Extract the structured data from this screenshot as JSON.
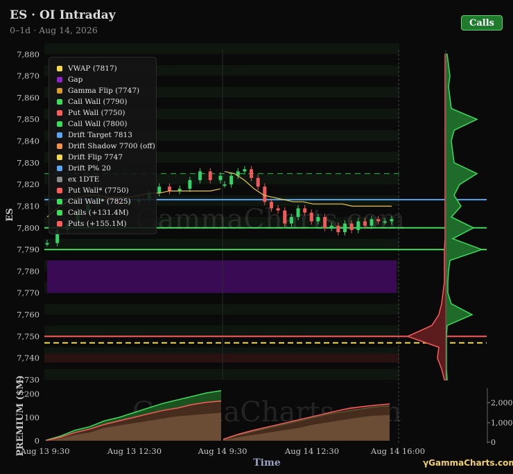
{
  "header": {
    "title": "ES · OI Intraday",
    "subtitle": "0–1d · Aug 14, 2026",
    "calls_button": "Calls"
  },
  "colors": {
    "background": "#0a0a0a",
    "call": "#3ddc5a",
    "put": "#ff5c5c",
    "vwap": "#e8c84a",
    "gap": "#7a1ea8",
    "drift_target": "#5aa7f0",
    "gamma_flip": "#d89a2e"
  },
  "chart_data": {
    "type": "line",
    "ylabel": "ES",
    "xlabel": "Time",
    "ylim": [
      7730,
      7882
    ],
    "yticks": [
      "7,880",
      "7,870",
      "7,860",
      "7,850",
      "7,840",
      "7,830",
      "7,820",
      "7,810",
      "7,800",
      "7,790",
      "7,780",
      "7,770",
      "7,760",
      "7,750",
      "7,740",
      "7,730"
    ],
    "xticks": [
      "Aug 13 9:30",
      "Aug 13 12:30",
      "Aug 14 9:30",
      "Aug 14 12:30",
      "Aug 14 16:00"
    ],
    "legend": [
      {
        "label": "VWAP (7817)",
        "color": "#f2d94e"
      },
      {
        "label": "Gap",
        "color": "#8e24c9"
      },
      {
        "label": "Gamma Flip (7747)",
        "color": "#d89a2e"
      },
      {
        "label": "Call Wall (7790)",
        "color": "#3ddc5a"
      },
      {
        "label": "Put Wall (7750)",
        "color": "#ff5c5c"
      },
      {
        "label": "Call Wall (7800)",
        "color": "#3ddc5a"
      },
      {
        "label": "Drift Target 7813",
        "color": "#5aa7f0"
      },
      {
        "label": "Drift Shadow 7700 (off)",
        "color": "#f0924a"
      },
      {
        "label": "Drift Flip 7747",
        "color": "#f2d94e"
      },
      {
        "label": "Drift P% 20",
        "color": "#5aa7f0"
      },
      {
        "label": "ex 1DTE",
        "color": "#8a8a8a"
      },
      {
        "label": "Put Wall* (7750)",
        "color": "#ff5c5c"
      },
      {
        "label": "Call Wall* (7825)",
        "color": "#3ddc5a"
      },
      {
        "label": "Calls (+131.4M)",
        "color": "#3ddc5a"
      },
      {
        "label": "Puts (+155.1M)",
        "color": "#ff5c5c"
      }
    ],
    "levels": {
      "call_wall_7790": 7790,
      "put_wall_7750": 7750,
      "call_wall_7800": 7800,
      "drift_target": 7813,
      "gamma_flip": 7747,
      "call_wall_star": 7825
    },
    "gap_zone": [
      7770,
      7785
    ],
    "price_series": [
      [
        7793,
        7799,
        7802,
        7808,
        7811,
        7814,
        7813,
        7812,
        7812,
        7813,
        7816,
        7819,
        7817,
        7818,
        7822,
        7826,
        7822,
        7824
      ],
      [
        7820,
        7824,
        7826,
        7827,
        7823,
        7819,
        7812,
        7809,
        7808,
        7802,
        7805,
        7809,
        7807,
        7803,
        7805,
        7800,
        7801,
        7798,
        7802,
        7799,
        7803,
        7801,
        7804,
        7803,
        7803,
        7804
      ]
    ],
    "vwap_series": [
      [
        7805,
        7809,
        7812,
        7814,
        7815,
        7815,
        7814,
        7814,
        7814,
        7815,
        7816,
        7816,
        7817,
        7817,
        7817,
        7817,
        7817,
        7818
      ],
      [
        7826,
        7825,
        7822,
        7818,
        7815,
        7814,
        7813,
        7812,
        7812,
        7811,
        7811,
        7811,
        7811,
        7810,
        7810,
        7810,
        7810,
        7810
      ]
    ],
    "premium": {
      "ylabel": "PREMIUM ($M)",
      "yticks": [
        "200",
        "100",
        "0"
      ],
      "ylim": [
        0,
        220
      ],
      "right_yticks": [
        "2,000",
        "1,000",
        "0"
      ],
      "calls": [
        [
          2,
          20,
          45,
          60,
          85,
          100,
          120,
          140,
          160,
          175,
          190,
          205,
          215
        ],
        [
          5,
          25,
          40,
          55,
          70,
          85,
          100,
          115,
          125,
          135,
          145,
          150
        ]
      ],
      "puts": [
        [
          1,
          15,
          35,
          50,
          70,
          85,
          100,
          115,
          130,
          140,
          155,
          165,
          170
        ],
        [
          6,
          28,
          45,
          60,
          75,
          90,
          105,
          120,
          135,
          145,
          152,
          158
        ]
      ],
      "net": [
        [
          0,
          10,
          25,
          35,
          55,
          65,
          75,
          85,
          95,
          105,
          110,
          115,
          120
        ],
        [
          3,
          15,
          25,
          35,
          45,
          55,
          70,
          80,
          90,
          100,
          108,
          110
        ]
      ]
    },
    "profile": {
      "levels": [
        7730,
        7735,
        7740,
        7745,
        7750,
        7755,
        7760,
        7765,
        7770,
        7775,
        7780,
        7785,
        7790,
        7795,
        7800,
        7805,
        7810,
        7815,
        7820,
        7825,
        7830,
        7835,
        7840,
        7845,
        7850,
        7855,
        7860,
        7865,
        7870,
        7875,
        7880
      ],
      "calls": [
        2,
        1,
        1,
        1,
        1,
        2,
        38,
        8,
        3,
        3,
        4,
        6,
        52,
        10,
        40,
        8,
        22,
        12,
        20,
        45,
        12,
        10,
        8,
        12,
        45,
        8,
        6,
        4,
        6,
        4,
        2
      ],
      "puts": [
        2,
        6,
        12,
        10,
        55,
        20,
        10,
        6,
        4,
        2,
        2,
        2,
        2,
        1,
        1,
        1,
        1,
        1,
        1,
        1,
        1,
        1,
        1,
        1,
        1,
        1,
        1,
        1,
        1,
        1,
        1
      ]
    }
  },
  "watermark": "GammaCharts.com",
  "footer": {
    "brand": "γGammaCharts.com"
  }
}
